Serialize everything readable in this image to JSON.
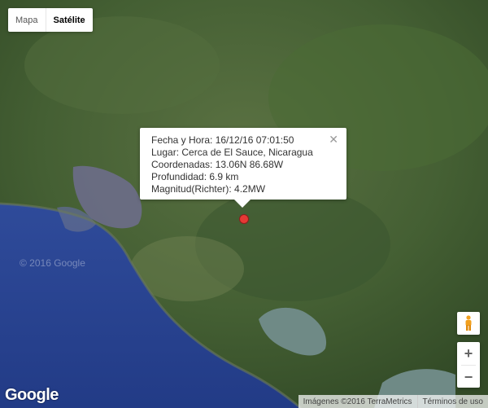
{
  "map_type": {
    "map_label": "Mapa",
    "satellite_label": "Satélite",
    "selected": "Satélite"
  },
  "info_window": {
    "line1": "Fecha y Hora: 16/12/16 07:01:50",
    "line2": "Lugar: Cerca de El Sauce, Nicaragua",
    "line3": "Coordenadas: 13.06N 86.68W",
    "line4": "Profundidad: 6.9 km",
    "line5": "Magnitud(Richter): 4.2MW",
    "close_icon": "close-icon"
  },
  "controls": {
    "zoom_in_label": "+",
    "zoom_out_label": "−",
    "pegman_icon": "pegman-icon"
  },
  "logo": {
    "text": "Google"
  },
  "watermark": {
    "text": "© 2016 Google"
  },
  "attribution": {
    "imagery": "Imágenes ©2016 TerraMetrics",
    "terms": "Términos de uso"
  },
  "colors": {
    "marker": "#e53935",
    "land": "#3e5a2e",
    "ocean": "#25428f",
    "lake": "#6f8a86"
  }
}
